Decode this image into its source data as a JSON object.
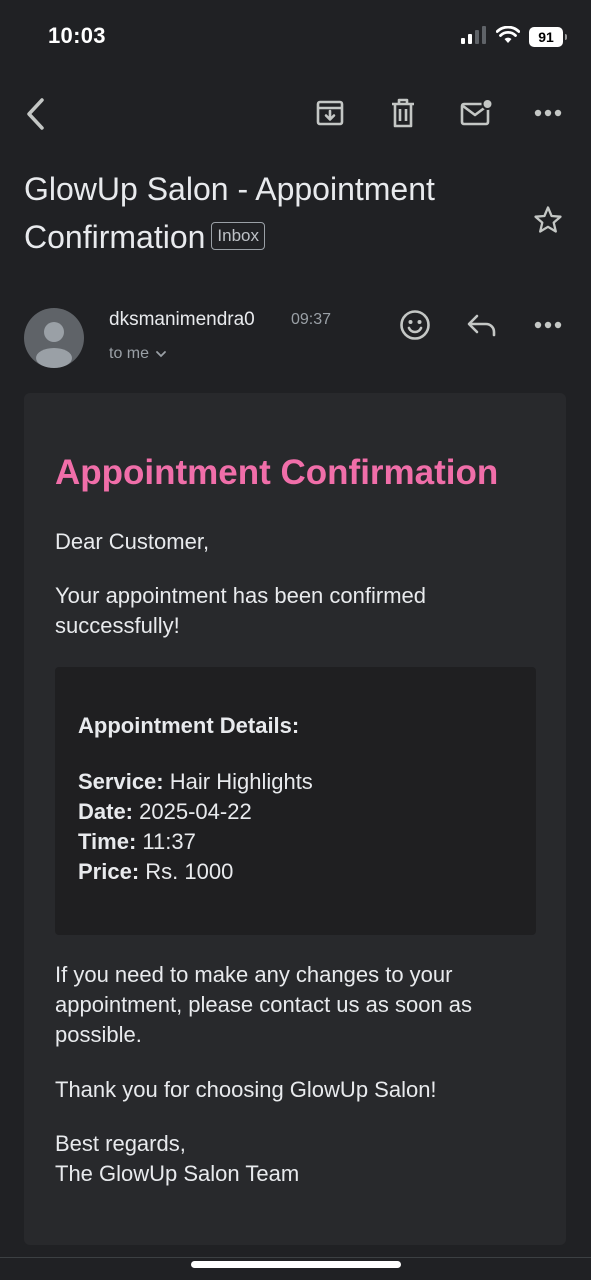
{
  "status_bar": {
    "time": "10:03",
    "battery": "91"
  },
  "toolbar": {
    "back_icon": "chevron-left-icon",
    "archive_icon": "archive-icon",
    "delete_icon": "trash-icon",
    "mark_unread_icon": "mail-unread-icon",
    "more_icon": "more-horizontal-icon"
  },
  "email": {
    "subject": "GlowUp Salon - Appointment Confirmation",
    "label": "Inbox",
    "sender": "dksmanimendra0",
    "time": "09:37",
    "recipient": "to me"
  },
  "body": {
    "heading": "Appointment Confirmation",
    "greeting": "Dear Customer,",
    "intro": "Your appointment has been confirmed successfully!",
    "details_title": "Appointment Details:",
    "details": [
      {
        "label": "Service:",
        "value": "Hair Highlights"
      },
      {
        "label": "Date:",
        "value": "2025-04-22"
      },
      {
        "label": "Time:",
        "value": "11:37"
      },
      {
        "label": "Price:",
        "value": "Rs. 1000"
      }
    ],
    "changes_note": "If you need to make any changes to your appointment, please contact us as soon as possible.",
    "thanks": "Thank you for choosing GlowUp Salon!",
    "closing": "Best regards,",
    "signature": "The GlowUp Salon Team"
  },
  "colors": {
    "accent": "#f06ea9",
    "background": "#202124",
    "card": "#28292c"
  }
}
